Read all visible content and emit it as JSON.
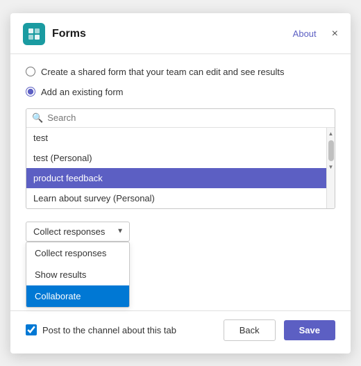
{
  "header": {
    "title": "Forms",
    "about_label": "About",
    "close_label": "×"
  },
  "options": {
    "create_shared_label": "Create a shared form that your team can edit and see results",
    "add_existing_label": "Add an existing form",
    "create_shared_selected": false,
    "add_existing_selected": true
  },
  "search": {
    "placeholder": "Search"
  },
  "form_list": {
    "items": [
      {
        "label": "test",
        "selected": false
      },
      {
        "label": "test (Personal)",
        "selected": false
      },
      {
        "label": "product feedback",
        "selected": true
      },
      {
        "label": "Learn about survey (Personal)",
        "selected": false
      }
    ]
  },
  "dropdown": {
    "current_value": "Collect responses",
    "arrow": "▼",
    "items": [
      {
        "label": "Collect responses",
        "selected": false
      },
      {
        "label": "Show results",
        "selected": false
      },
      {
        "label": "Collaborate",
        "selected": true
      }
    ]
  },
  "footer": {
    "post_to_channel_label": "Post to the channel about this tab",
    "back_label": "Back",
    "save_label": "Save"
  }
}
